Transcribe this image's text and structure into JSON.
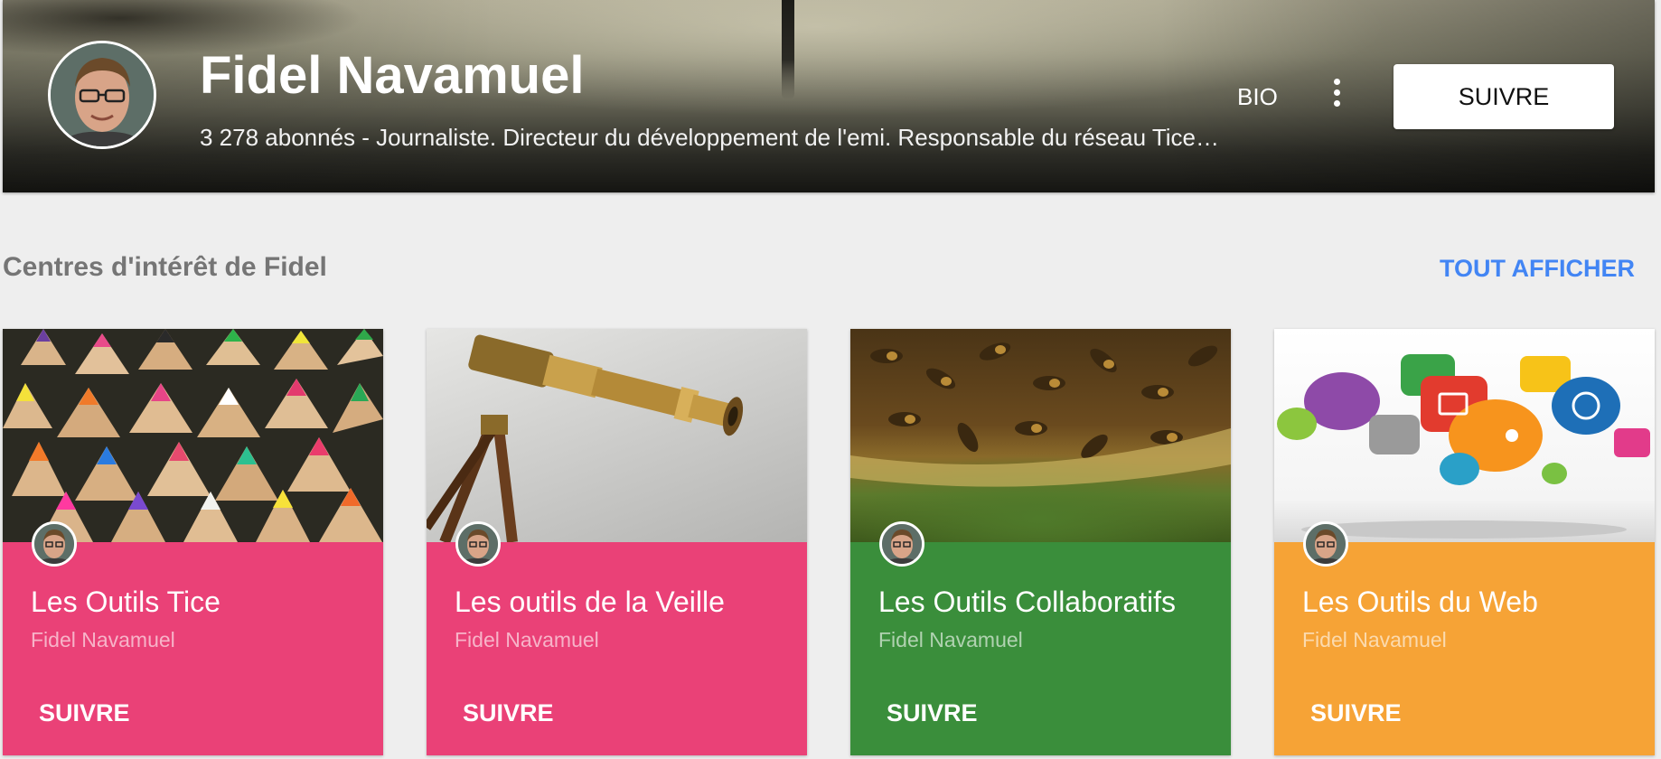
{
  "profile": {
    "name": "Fidel Navamuel",
    "description": "3 278 abonnés - Journaliste. Directeur du développement de l'emi. Responsable du réseau Tice…",
    "bio_label": "BIO",
    "follow_label": "SUIVRE"
  },
  "interests": {
    "title": "Centres d'intérêt de Fidel",
    "show_all": "TOUT AFFICHER",
    "cards": [
      {
        "title": "Les Outils Tice",
        "author": "Fidel Navamuel",
        "follow": "SUIVRE",
        "color": "#ea4177",
        "image": "colored-pencils"
      },
      {
        "title": "Les outils de la Veille",
        "author": "Fidel Navamuel",
        "follow": "SUIVRE",
        "color": "#ea4177",
        "image": "brass-telescope"
      },
      {
        "title": "Les Outils Collaboratifs",
        "author": "Fidel Navamuel",
        "follow": "SUIVRE",
        "color": "#3a8e3b",
        "image": "bees-on-honeycomb"
      },
      {
        "title": "Les Outils du Web",
        "author": "Fidel Navamuel",
        "follow": "SUIVRE",
        "color": "#f6a336",
        "image": "web-icons-bubbles"
      }
    ]
  },
  "icons": {
    "more": "more-vert-icon"
  }
}
